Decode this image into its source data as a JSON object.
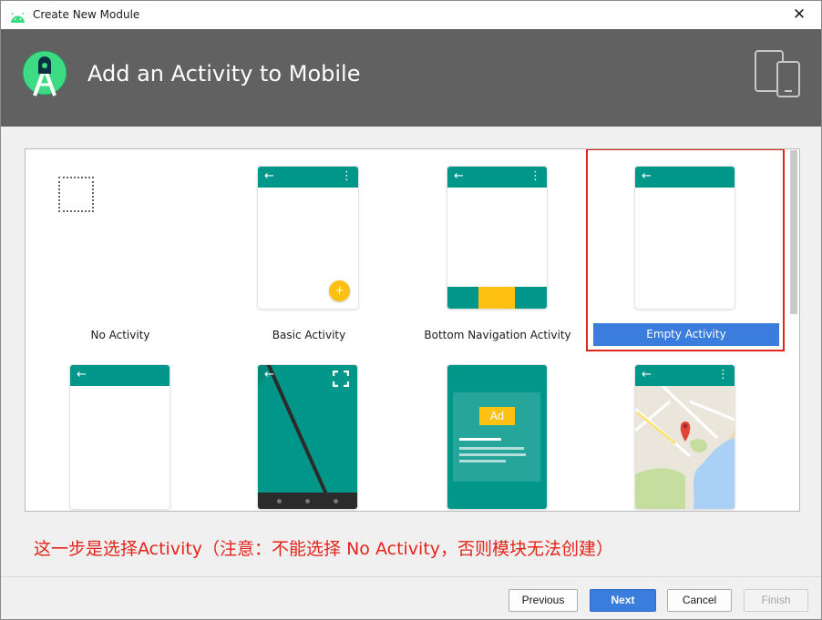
{
  "window": {
    "title": "Create New Module",
    "close_label": "✕"
  },
  "header": {
    "title": "Add an Activity to Mobile"
  },
  "gallery": {
    "items": [
      {
        "label": "No Activity"
      },
      {
        "label": "Basic Activity"
      },
      {
        "label": "Bottom Navigation Activity"
      },
      {
        "label": "Empty Activity"
      },
      {
        "label": ""
      },
      {
        "label": ""
      },
      {
        "label": ""
      },
      {
        "label": ""
      }
    ],
    "selected_index": 3,
    "ad_label": "Ad",
    "arrow_glyph": "←",
    "menu_glyph": "⋮",
    "fab_glyph": "+"
  },
  "note": "这一步是选择Activity（注意：不能选择 No Activity，否则模块无法创建）",
  "buttons": {
    "previous": "Previous",
    "next": "Next",
    "cancel": "Cancel",
    "finish": "Finish"
  },
  "colors": {
    "header_bg": "#616161",
    "teal": "#00968a",
    "amber": "#fec111",
    "selection_blue": "#3b7ddd",
    "annotation_red": "#e3241b"
  }
}
